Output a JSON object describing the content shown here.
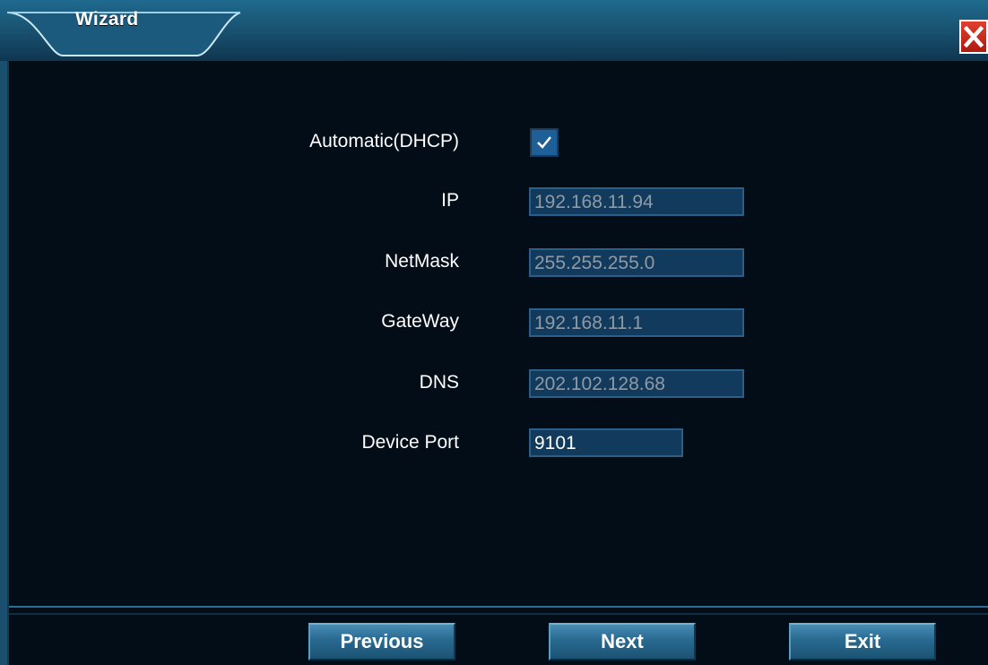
{
  "window": {
    "title": "Wizard"
  },
  "form": {
    "dhcp": {
      "label": "Automatic(DHCP)",
      "checked": true
    },
    "ip": {
      "label": "IP",
      "value": "192.168.11.94"
    },
    "netmask": {
      "label": "NetMask",
      "value": "255.255.255.0"
    },
    "gateway": {
      "label": "GateWay",
      "value": "192.168.11.1"
    },
    "dns": {
      "label": "DNS",
      "value": "202.102.128.68"
    },
    "device_port": {
      "label": "Device Port",
      "value": "9101"
    }
  },
  "footer": {
    "previous_label": "Previous",
    "next_label": "Next",
    "exit_label": "Exit"
  },
  "colors": {
    "background": "#020d18",
    "frame": "#1a4f70",
    "field_bg": "#123a5c",
    "close_red": "#c8281c"
  }
}
